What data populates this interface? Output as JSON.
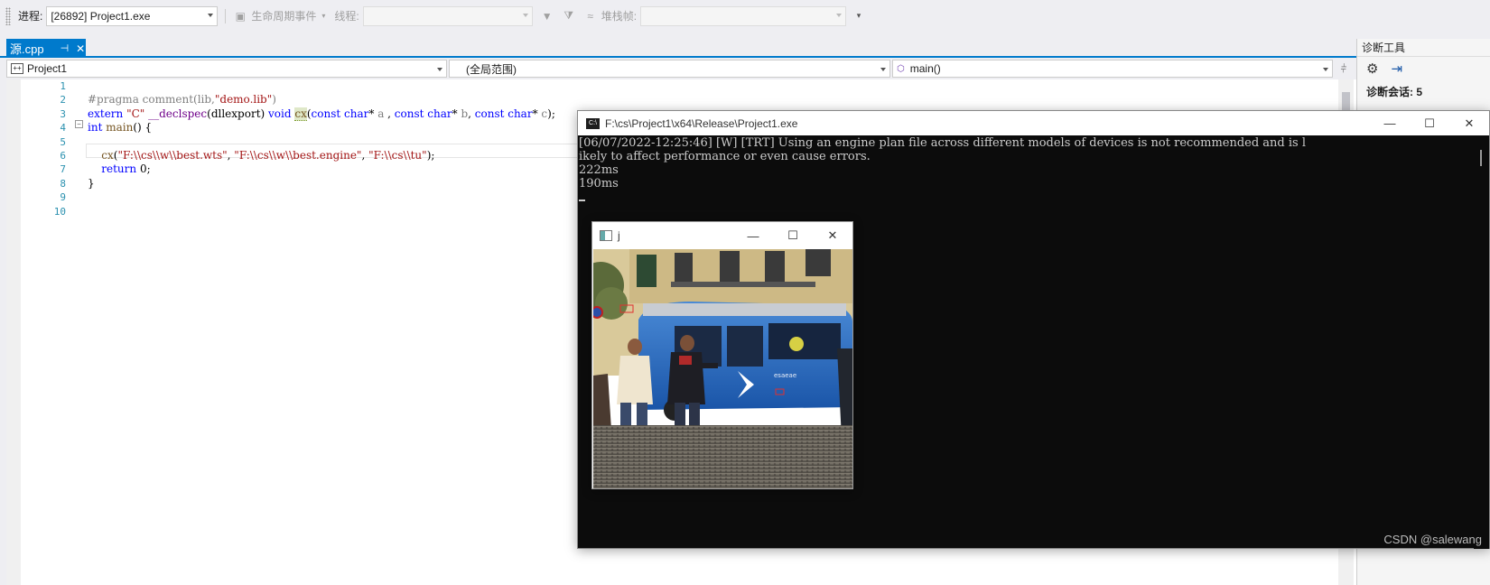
{
  "toolbar": {
    "process_label": "进程:",
    "process_value": "[26892] Project1.exe",
    "lifecycle_label": "生命周期事件",
    "thread_label": "线程:",
    "stackframe_label": "堆栈帧:"
  },
  "tab": {
    "label": "源.cpp",
    "pin": "⊣",
    "close": "✕"
  },
  "navbar": {
    "project": "Project1",
    "scope": "(全局范围)",
    "member": "main()"
  },
  "editor": {
    "line_numbers": [
      "1",
      "2",
      "3",
      "4",
      "5",
      "6",
      "7",
      "8",
      "9",
      "10"
    ]
  },
  "diagnostics": {
    "title": "诊断工具",
    "session_label": "诊断会话: 5"
  },
  "console": {
    "title": "F:\\cs\\Project1\\x64\\Release\\Project1.exe",
    "lines": [
      "[06/07/2022-12:25:46] [W] [TRT] Using an engine plan file across different models of devices is not recommended and is l",
      "ikely to affect performance or even cause errors.",
      "222ms",
      "190ms"
    ],
    "watermark": "CSDN @salewang"
  },
  "image_window": {
    "title": "j"
  },
  "window_buttons": {
    "minimize": "—",
    "maximize": "☐",
    "close": "✕"
  },
  "colors": {
    "accent": "#007acc",
    "keyword": "#0000ff",
    "string": "#a31515",
    "line_number": "#2b91af",
    "console_bg": "#0c0c0c"
  }
}
